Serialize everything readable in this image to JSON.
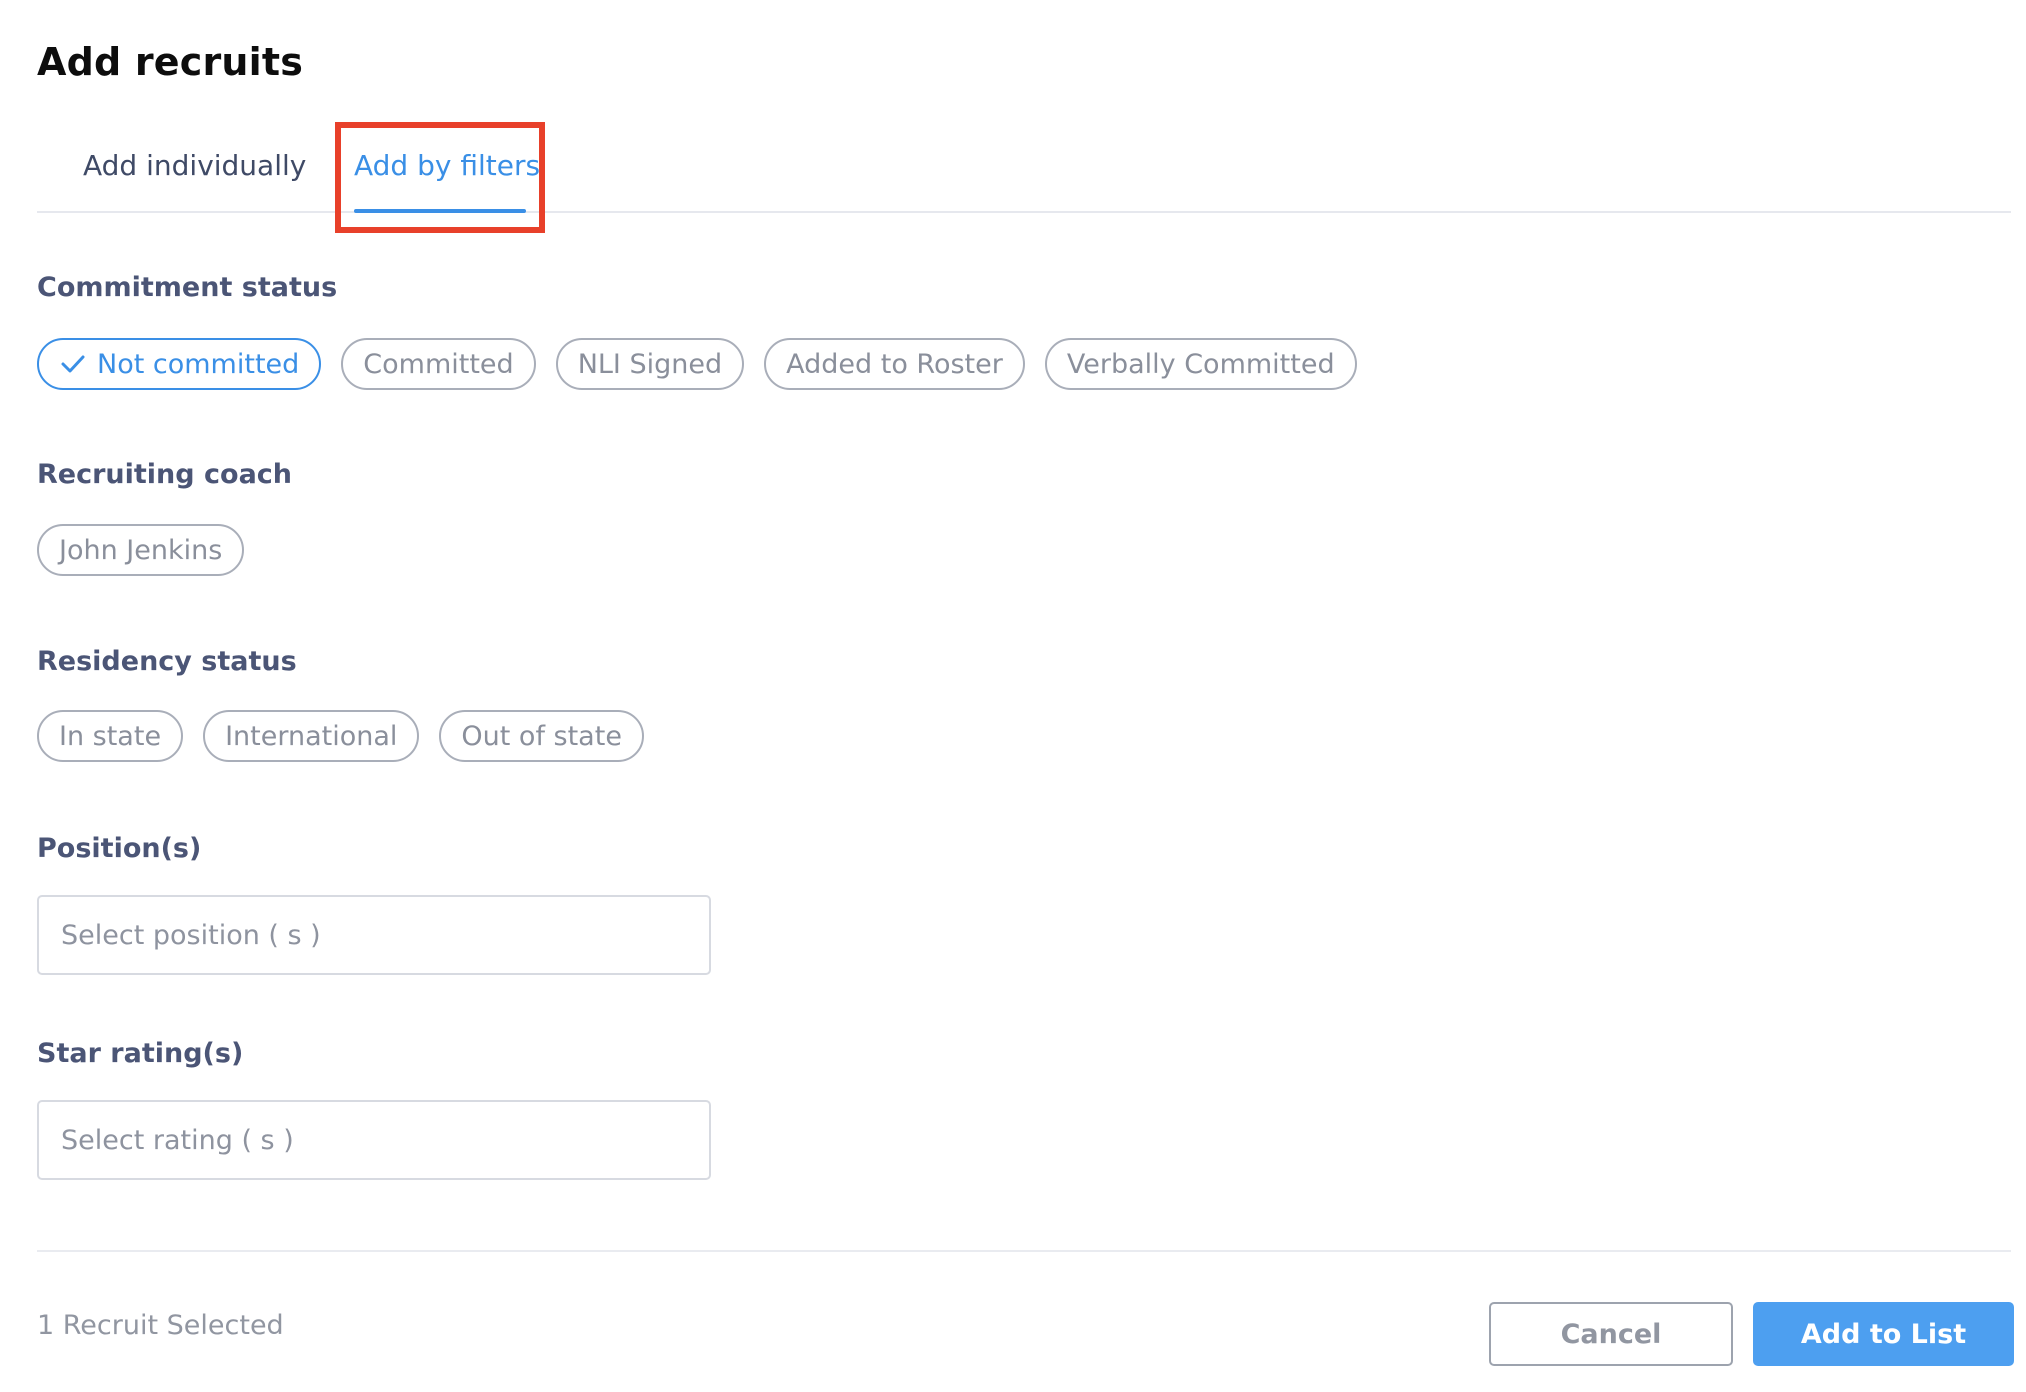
{
  "dialog": {
    "title": "Add recruits"
  },
  "tabs": [
    {
      "label": "Add individually",
      "active": false
    },
    {
      "label": "Add by filters",
      "active": true
    }
  ],
  "filters": {
    "commitment_status": {
      "label": "Commitment status",
      "options": [
        {
          "label": "Not committed",
          "selected": true
        },
        {
          "label": "Committed",
          "selected": false
        },
        {
          "label": "NLI Signed",
          "selected": false
        },
        {
          "label": "Added to Roster",
          "selected": false
        },
        {
          "label": "Verbally Committed",
          "selected": false
        }
      ]
    },
    "recruiting_coach": {
      "label": "Recruiting coach",
      "options": [
        {
          "label": "John Jenkins",
          "selected": false
        }
      ]
    },
    "residency_status": {
      "label": "Residency status",
      "options": [
        {
          "label": "In state",
          "selected": false
        },
        {
          "label": "International",
          "selected": false
        },
        {
          "label": "Out of state",
          "selected": false
        }
      ]
    },
    "positions": {
      "label": "Position(s)",
      "placeholder": "Select position ( s )"
    },
    "star_ratings": {
      "label": "Star rating(s)",
      "placeholder": "Select rating ( s )"
    }
  },
  "footer": {
    "status": "1 Recruit Selected",
    "cancel_label": "Cancel",
    "add_label": "Add to List"
  },
  "colors": {
    "accent": "#3a8fe6",
    "primary_button": "#4d9ff0",
    "highlight": "#e8402a"
  },
  "icons": {
    "selected_chip": "check-icon"
  }
}
